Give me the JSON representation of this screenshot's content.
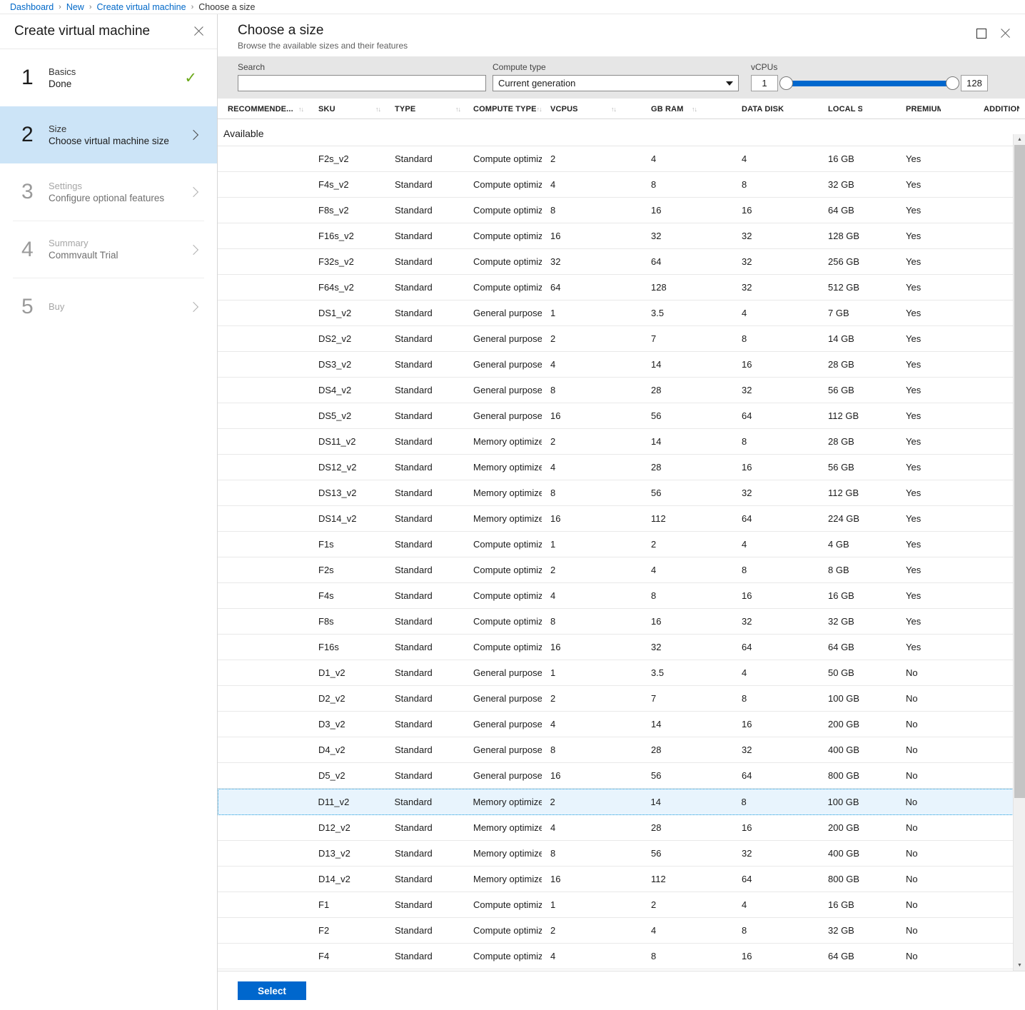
{
  "breadcrumb": {
    "items": [
      {
        "label": "Dashboard",
        "link": true
      },
      {
        "label": "New",
        "link": true
      },
      {
        "label": "Create virtual machine",
        "link": true
      },
      {
        "label": "Choose a size",
        "link": false
      }
    ],
    "separator": "›"
  },
  "left_blade": {
    "title": "Create virtual machine",
    "close_icon": "close-icon",
    "steps": [
      {
        "num": "1",
        "title": "Basics",
        "sub": "Done",
        "state": "done",
        "marker": "check"
      },
      {
        "num": "2",
        "title": "Size",
        "sub": "Choose virtual machine size",
        "state": "selected",
        "marker": "chevron"
      },
      {
        "num": "3",
        "title": "Settings",
        "sub": "Configure optional features",
        "state": "disabled",
        "marker": "chevron"
      },
      {
        "num": "4",
        "title": "Summary",
        "sub": "Commvault Trial",
        "state": "disabled",
        "marker": "chevron"
      },
      {
        "num": "5",
        "title": "Buy",
        "sub": "",
        "state": "disabled",
        "marker": "chevron"
      }
    ]
  },
  "right_blade": {
    "title": "Choose a size",
    "subtitle": "Browse the available sizes and their features",
    "maximize_icon": "maximize-icon",
    "close_icon": "close-icon",
    "filters": {
      "search_label": "Search",
      "search_value": "",
      "search_placeholder": "",
      "compute_type_label": "Compute type",
      "compute_type_value": "Current generation",
      "vcpus_label": "vCPUs",
      "vcpus_min": "1",
      "vcpus_max": "128"
    },
    "table": {
      "sort_icon": "↑↓",
      "columns": [
        {
          "key": "recommended",
          "label": "RECOMMENDE..."
        },
        {
          "key": "sku",
          "label": "SKU"
        },
        {
          "key": "type",
          "label": "TYPE"
        },
        {
          "key": "compute_type",
          "label": "COMPUTE TYPE"
        },
        {
          "key": "vcpus",
          "label": "VCPUS"
        },
        {
          "key": "gb_ram",
          "label": "GB RAM"
        },
        {
          "key": "data_disks",
          "label": "DATA DISKS"
        },
        {
          "key": "local_ssd",
          "label": "LOCAL SSD"
        },
        {
          "key": "premium_disk",
          "label": "PREMIUM DIS..."
        },
        {
          "key": "additional",
          "label": "ADDITIONAL F..."
        }
      ],
      "group_label": "Available",
      "rows": [
        {
          "recommended": "",
          "sku": "F2s_v2",
          "type": "Standard",
          "compute_type": "Compute optimized",
          "vcpus": "2",
          "gb_ram": "4",
          "data_disks": "4",
          "local_ssd": "16 GB",
          "premium_disk": "Yes",
          "additional": "",
          "selected": false
        },
        {
          "recommended": "",
          "sku": "F4s_v2",
          "type": "Standard",
          "compute_type": "Compute optimized",
          "vcpus": "4",
          "gb_ram": "8",
          "data_disks": "8",
          "local_ssd": "32 GB",
          "premium_disk": "Yes",
          "additional": "",
          "selected": false
        },
        {
          "recommended": "",
          "sku": "F8s_v2",
          "type": "Standard",
          "compute_type": "Compute optimized",
          "vcpus": "8",
          "gb_ram": "16",
          "data_disks": "16",
          "local_ssd": "64 GB",
          "premium_disk": "Yes",
          "additional": "",
          "selected": false
        },
        {
          "recommended": "",
          "sku": "F16s_v2",
          "type": "Standard",
          "compute_type": "Compute optimized",
          "vcpus": "16",
          "gb_ram": "32",
          "data_disks": "32",
          "local_ssd": "128 GB",
          "premium_disk": "Yes",
          "additional": "",
          "selected": false
        },
        {
          "recommended": "",
          "sku": "F32s_v2",
          "type": "Standard",
          "compute_type": "Compute optimized",
          "vcpus": "32",
          "gb_ram": "64",
          "data_disks": "32",
          "local_ssd": "256 GB",
          "premium_disk": "Yes",
          "additional": "",
          "selected": false
        },
        {
          "recommended": "",
          "sku": "F64s_v2",
          "type": "Standard",
          "compute_type": "Compute optimized",
          "vcpus": "64",
          "gb_ram": "128",
          "data_disks": "32",
          "local_ssd": "512 GB",
          "premium_disk": "Yes",
          "additional": "",
          "selected": false
        },
        {
          "recommended": "",
          "sku": "DS1_v2",
          "type": "Standard",
          "compute_type": "General purpose",
          "vcpus": "1",
          "gb_ram": "3.5",
          "data_disks": "4",
          "local_ssd": "7 GB",
          "premium_disk": "Yes",
          "additional": "",
          "selected": false
        },
        {
          "recommended": "",
          "sku": "DS2_v2",
          "type": "Standard",
          "compute_type": "General purpose",
          "vcpus": "2",
          "gb_ram": "7",
          "data_disks": "8",
          "local_ssd": "14 GB",
          "premium_disk": "Yes",
          "additional": "",
          "selected": false
        },
        {
          "recommended": "",
          "sku": "DS3_v2",
          "type": "Standard",
          "compute_type": "General purpose",
          "vcpus": "4",
          "gb_ram": "14",
          "data_disks": "16",
          "local_ssd": "28 GB",
          "premium_disk": "Yes",
          "additional": "",
          "selected": false
        },
        {
          "recommended": "",
          "sku": "DS4_v2",
          "type": "Standard",
          "compute_type": "General purpose",
          "vcpus": "8",
          "gb_ram": "28",
          "data_disks": "32",
          "local_ssd": "56 GB",
          "premium_disk": "Yes",
          "additional": "",
          "selected": false
        },
        {
          "recommended": "",
          "sku": "DS5_v2",
          "type": "Standard",
          "compute_type": "General purpose",
          "vcpus": "16",
          "gb_ram": "56",
          "data_disks": "64",
          "local_ssd": "112 GB",
          "premium_disk": "Yes",
          "additional": "",
          "selected": false
        },
        {
          "recommended": "",
          "sku": "DS11_v2",
          "type": "Standard",
          "compute_type": "Memory optimized",
          "vcpus": "2",
          "gb_ram": "14",
          "data_disks": "8",
          "local_ssd": "28 GB",
          "premium_disk": "Yes",
          "additional": "",
          "selected": false
        },
        {
          "recommended": "",
          "sku": "DS12_v2",
          "type": "Standard",
          "compute_type": "Memory optimized",
          "vcpus": "4",
          "gb_ram": "28",
          "data_disks": "16",
          "local_ssd": "56 GB",
          "premium_disk": "Yes",
          "additional": "",
          "selected": false
        },
        {
          "recommended": "",
          "sku": "DS13_v2",
          "type": "Standard",
          "compute_type": "Memory optimized",
          "vcpus": "8",
          "gb_ram": "56",
          "data_disks": "32",
          "local_ssd": "112 GB",
          "premium_disk": "Yes",
          "additional": "",
          "selected": false
        },
        {
          "recommended": "",
          "sku": "DS14_v2",
          "type": "Standard",
          "compute_type": "Memory optimized",
          "vcpus": "16",
          "gb_ram": "112",
          "data_disks": "64",
          "local_ssd": "224 GB",
          "premium_disk": "Yes",
          "additional": "",
          "selected": false
        },
        {
          "recommended": "",
          "sku": "F1s",
          "type": "Standard",
          "compute_type": "Compute optimized",
          "vcpus": "1",
          "gb_ram": "2",
          "data_disks": "4",
          "local_ssd": "4 GB",
          "premium_disk": "Yes",
          "additional": "",
          "selected": false
        },
        {
          "recommended": "",
          "sku": "F2s",
          "type": "Standard",
          "compute_type": "Compute optimized",
          "vcpus": "2",
          "gb_ram": "4",
          "data_disks": "8",
          "local_ssd": "8 GB",
          "premium_disk": "Yes",
          "additional": "",
          "selected": false
        },
        {
          "recommended": "",
          "sku": "F4s",
          "type": "Standard",
          "compute_type": "Compute optimized",
          "vcpus": "4",
          "gb_ram": "8",
          "data_disks": "16",
          "local_ssd": "16 GB",
          "premium_disk": "Yes",
          "additional": "",
          "selected": false
        },
        {
          "recommended": "",
          "sku": "F8s",
          "type": "Standard",
          "compute_type": "Compute optimized",
          "vcpus": "8",
          "gb_ram": "16",
          "data_disks": "32",
          "local_ssd": "32 GB",
          "premium_disk": "Yes",
          "additional": "",
          "selected": false
        },
        {
          "recommended": "",
          "sku": "F16s",
          "type": "Standard",
          "compute_type": "Compute optimized",
          "vcpus": "16",
          "gb_ram": "32",
          "data_disks": "64",
          "local_ssd": "64 GB",
          "premium_disk": "Yes",
          "additional": "",
          "selected": false
        },
        {
          "recommended": "",
          "sku": "D1_v2",
          "type": "Standard",
          "compute_type": "General purpose",
          "vcpus": "1",
          "gb_ram": "3.5",
          "data_disks": "4",
          "local_ssd": "50 GB",
          "premium_disk": "No",
          "additional": "",
          "selected": false
        },
        {
          "recommended": "",
          "sku": "D2_v2",
          "type": "Standard",
          "compute_type": "General purpose",
          "vcpus": "2",
          "gb_ram": "7",
          "data_disks": "8",
          "local_ssd": "100 GB",
          "premium_disk": "No",
          "additional": "",
          "selected": false
        },
        {
          "recommended": "",
          "sku": "D3_v2",
          "type": "Standard",
          "compute_type": "General purpose",
          "vcpus": "4",
          "gb_ram": "14",
          "data_disks": "16",
          "local_ssd": "200 GB",
          "premium_disk": "No",
          "additional": "",
          "selected": false
        },
        {
          "recommended": "",
          "sku": "D4_v2",
          "type": "Standard",
          "compute_type": "General purpose",
          "vcpus": "8",
          "gb_ram": "28",
          "data_disks": "32",
          "local_ssd": "400 GB",
          "premium_disk": "No",
          "additional": "",
          "selected": false
        },
        {
          "recommended": "",
          "sku": "D5_v2",
          "type": "Standard",
          "compute_type": "General purpose",
          "vcpus": "16",
          "gb_ram": "56",
          "data_disks": "64",
          "local_ssd": "800 GB",
          "premium_disk": "No",
          "additional": "",
          "selected": false
        },
        {
          "recommended": "",
          "sku": "D11_v2",
          "type": "Standard",
          "compute_type": "Memory optimized",
          "vcpus": "2",
          "gb_ram": "14",
          "data_disks": "8",
          "local_ssd": "100 GB",
          "premium_disk": "No",
          "additional": "",
          "selected": true
        },
        {
          "recommended": "",
          "sku": "D12_v2",
          "type": "Standard",
          "compute_type": "Memory optimized",
          "vcpus": "4",
          "gb_ram": "28",
          "data_disks": "16",
          "local_ssd": "200 GB",
          "premium_disk": "No",
          "additional": "",
          "selected": false
        },
        {
          "recommended": "",
          "sku": "D13_v2",
          "type": "Standard",
          "compute_type": "Memory optimized",
          "vcpus": "8",
          "gb_ram": "56",
          "data_disks": "32",
          "local_ssd": "400 GB",
          "premium_disk": "No",
          "additional": "",
          "selected": false
        },
        {
          "recommended": "",
          "sku": "D14_v2",
          "type": "Standard",
          "compute_type": "Memory optimized",
          "vcpus": "16",
          "gb_ram": "112",
          "data_disks": "64",
          "local_ssd": "800 GB",
          "premium_disk": "No",
          "additional": "",
          "selected": false
        },
        {
          "recommended": "",
          "sku": "F1",
          "type": "Standard",
          "compute_type": "Compute optimized",
          "vcpus": "1",
          "gb_ram": "2",
          "data_disks": "4",
          "local_ssd": "16 GB",
          "premium_disk": "No",
          "additional": "",
          "selected": false
        },
        {
          "recommended": "",
          "sku": "F2",
          "type": "Standard",
          "compute_type": "Compute optimized",
          "vcpus": "2",
          "gb_ram": "4",
          "data_disks": "8",
          "local_ssd": "32 GB",
          "premium_disk": "No",
          "additional": "",
          "selected": false
        },
        {
          "recommended": "",
          "sku": "F4",
          "type": "Standard",
          "compute_type": "Compute optimized",
          "vcpus": "4",
          "gb_ram": "8",
          "data_disks": "16",
          "local_ssd": "64 GB",
          "premium_disk": "No",
          "additional": "",
          "selected": false
        }
      ]
    },
    "footer": {
      "select_label": "Select"
    }
  },
  "colors": {
    "accent": "#0067cd",
    "link": "#0068c8",
    "selected_step_bg": "#cce4f7",
    "selected_row_bg": "#e8f4fd",
    "selected_row_border": "#1a9bdd",
    "check_green": "#6aa818",
    "filter_bar_bg": "#e6e6e6"
  }
}
